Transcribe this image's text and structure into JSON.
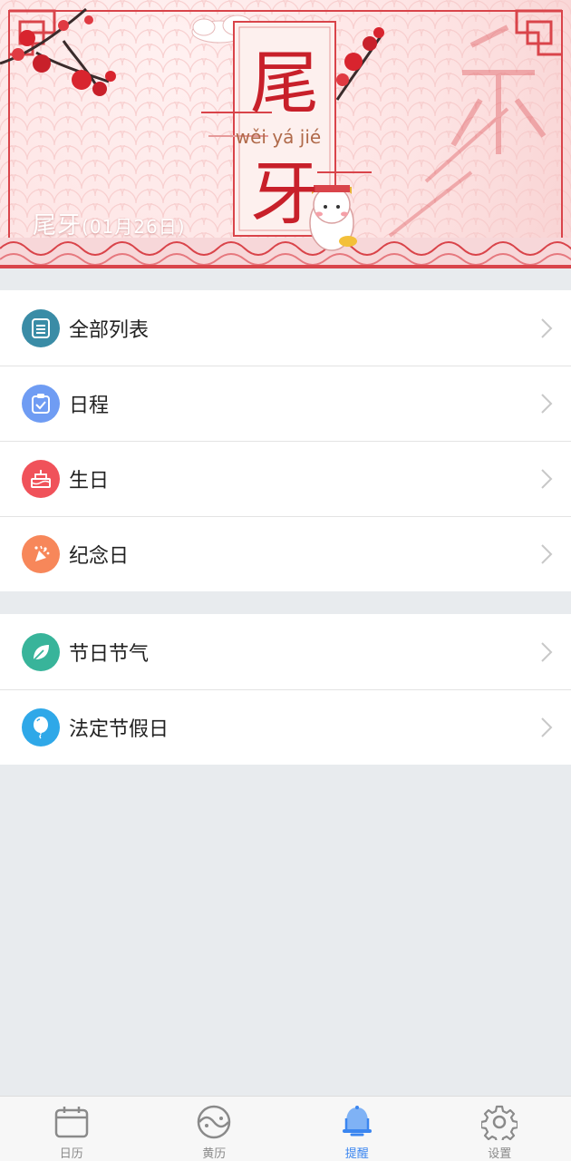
{
  "banner": {
    "title_char_1": "尾",
    "title_char_2": "牙",
    "pinyin": "wěi yá jié",
    "caption_name": "尾牙",
    "caption_date": "(01月26日)"
  },
  "groups": [
    {
      "items": [
        {
          "label": "全部列表",
          "icon": "list-icon",
          "color": "#3a8ca6"
        },
        {
          "label": "日程",
          "icon": "schedule-clipboard-icon",
          "color": "#6f9cf3"
        },
        {
          "label": "生日",
          "icon": "birthday-cake-icon",
          "color": "#f0525a"
        },
        {
          "label": "纪念日",
          "icon": "party-popper-icon",
          "color": "#f7875a"
        }
      ]
    },
    {
      "items": [
        {
          "label": "节日节气",
          "icon": "leaf-icon",
          "color": "#38b49a"
        },
        {
          "label": "法定节假日",
          "icon": "balloon-icon",
          "color": "#2fa8e8"
        }
      ]
    }
  ],
  "tabbar": {
    "tabs": [
      {
        "label": "日历",
        "icon": "calendar-icon",
        "active": false
      },
      {
        "label": "黄历",
        "icon": "yin-yang-icon",
        "active": false
      },
      {
        "label": "提醒",
        "icon": "bell-icon",
        "active": true
      },
      {
        "label": "设置",
        "icon": "gear-icon",
        "active": false
      }
    ],
    "active_color": "#3b86f0",
    "inactive_color": "#8a8a8a"
  }
}
